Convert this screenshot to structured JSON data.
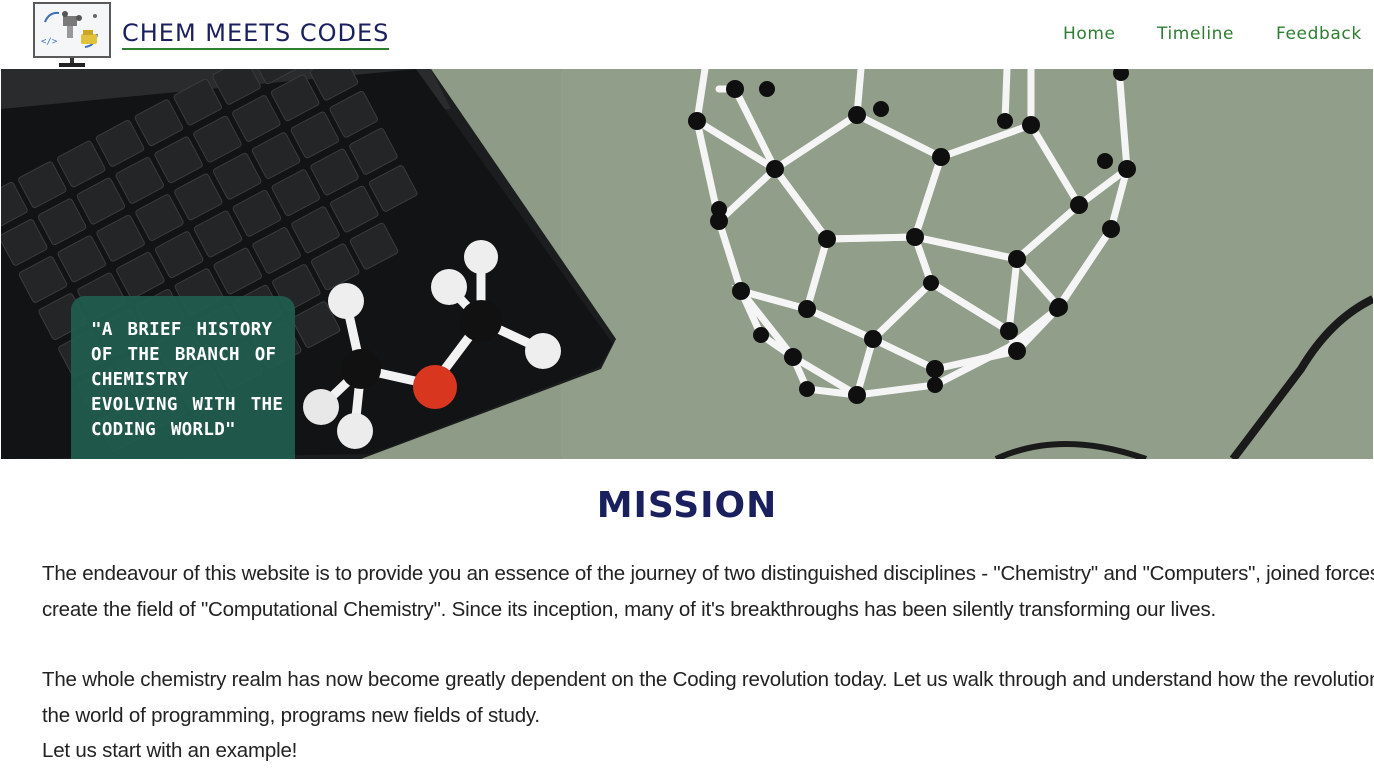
{
  "header": {
    "brand": "CHEM MEETS CODES",
    "nav": {
      "home": "Home",
      "timeline": "Timeline",
      "feedback": "Feedback"
    }
  },
  "hero": {
    "quote_lines": [
      "\"A  BRIEF  HISTORY",
      "OF THE BRANCH OF",
      "CHEMISTRY",
      "EVOLVING WITH THE",
      "CODING WORLD\""
    ]
  },
  "mission": {
    "title": "MISSION",
    "paragraph_1": [
      "The endeavour of this website is to provide you an essence of the journey of two distinguished disciplines - \"Chemistry\" and \"Computers\", joined forces to",
      "create the field of \"Computational Chemistry\". Since its inception, many of it's breakthroughs has been silently transforming our lives."
    ],
    "paragraph_2": [
      "The whole chemistry realm has now become greatly dependent on the Coding revolution today. Let us walk through and understand how the revolution in",
      "the world of programming, programs new fields of study.",
      "Let us start with an example!"
    ]
  },
  "colors": {
    "brand_navy": "#1a1f5e",
    "nav_green": "#2e7d32",
    "quote_card": "#215c50",
    "hero_background": "#8d9a85"
  },
  "icons": {
    "logo": "chemistry-computer-logo-icon"
  }
}
